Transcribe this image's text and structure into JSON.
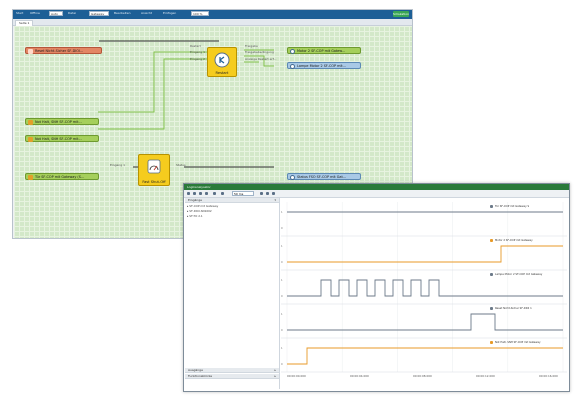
{
  "editor": {
    "toolbar": {
      "items": [
        "Start",
        "Offline",
        "Datei",
        "Bearbeiten",
        "Ansicht",
        "Einfügen"
      ],
      "field1": "Auto",
      "field2": "Gateway",
      "field3": "100 %",
      "simulate_label": "Simulation"
    },
    "tab_label": "Seite 1",
    "inputs": [
      {
        "label": "Reset Nicht-Sicher SF-DIOI..."
      },
      {
        "label": "Not Halt, SNH SF-COP mit..."
      },
      {
        "label": "Not Halt, SNH SF-COP mit..."
      },
      {
        "label": "Tür SF-COP mit Gateway (S..."
      }
    ],
    "restart_block": {
      "title": "Restart",
      "ports_in": [
        "Restart",
        "Eingang 1",
        "Eingang 2"
      ],
      "ports_out": [
        "Freigabe",
        "Freigabebedingung",
        "Anzeige Restart erf..."
      ]
    },
    "fso_block": {
      "title": "Fast Shut-Off",
      "ports_in": [
        "Eingang 1"
      ],
      "ports_out": [
        "Status"
      ]
    },
    "outputs": [
      {
        "label": "Motor 2 SF-COP mit Gatew..."
      },
      {
        "label": "Lampe Motor 2 SF-COP mit..."
      },
      {
        "label": "Status FSO SF-COP mit Gat..."
      }
    ]
  },
  "monitor": {
    "title": "Logikanalysator",
    "input_value": "50 ms",
    "left_panel": {
      "header": "Eingänge",
      "items": [
        "SF-COP mit Gateway",
        "SF-DIOI-SN1002",
        "SF-TO 2.1"
      ],
      "bottom_header_1": "Ausgänge",
      "bottom_header_2": "Funktionsblöcke"
    },
    "signals": [
      {
        "label": "Tür SF-COP mit Gateway S",
        "trace": "flat",
        "color": "#6c7a89"
      },
      {
        "label": "Motor 2 SF-COP mit Gateway",
        "trace": "step_late",
        "color": "#e89a27"
      },
      {
        "label": "Lampe Motor 2 SF-COP mit Gateway",
        "trace": "pulses",
        "color": "#6c7a89"
      },
      {
        "label": "Reset Nicht-Sicher SF-DIOI 1",
        "trace": "pulse_late",
        "color": "#6c7a89"
      },
      {
        "label": "Not Halt, SNH SF-COP mit Gateway",
        "trace": "step_early",
        "color": "#e89a27"
      }
    ],
    "time_labels": [
      "00:00:00.000",
      "00:00:04.000",
      "00:00:08.000",
      "00:00:12.000",
      "00:00:16.000"
    ],
    "y_labels": [
      "1",
      "0",
      "1",
      "0",
      "1",
      "0",
      "1",
      "0",
      "1",
      "0"
    ],
    "colors": {
      "titlebar": "#2a7a3a",
      "toolbar": "#1d5f96",
      "grid": "#d3e8c9",
      "trace_orange": "#e89a27",
      "trace_gray": "#6c7a89"
    }
  }
}
